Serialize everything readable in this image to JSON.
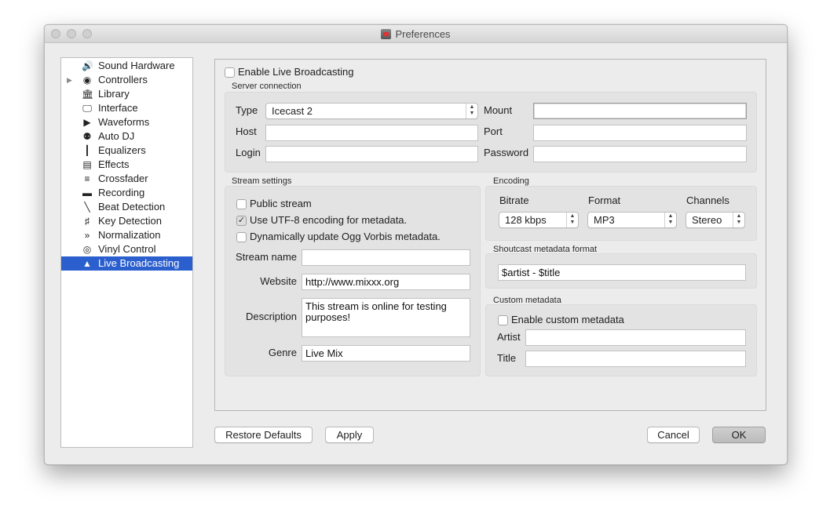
{
  "window": {
    "title": "Preferences"
  },
  "sidebar": {
    "items": [
      {
        "label": "Sound Hardware",
        "icon": "speaker-icon",
        "glyph": "🔊"
      },
      {
        "label": "Controllers",
        "icon": "controller-icon",
        "glyph": "◉",
        "expandable": true
      },
      {
        "label": "Library",
        "icon": "library-icon",
        "glyph": "🏛"
      },
      {
        "label": "Interface",
        "icon": "monitor-icon",
        "glyph": "🖵"
      },
      {
        "label": "Waveforms",
        "icon": "waveform-icon",
        "glyph": "▶"
      },
      {
        "label": "Auto DJ",
        "icon": "robot-icon",
        "glyph": "⚉"
      },
      {
        "label": "Equalizers",
        "icon": "equalizer-icon",
        "glyph": "┃"
      },
      {
        "label": "Effects",
        "icon": "effects-icon",
        "glyph": "▤"
      },
      {
        "label": "Crossfader",
        "icon": "crossfader-icon",
        "glyph": "≡"
      },
      {
        "label": "Recording",
        "icon": "recording-icon",
        "glyph": "▬"
      },
      {
        "label": "Beat Detection",
        "icon": "beat-detection-icon",
        "glyph": "╲"
      },
      {
        "label": "Key Detection",
        "icon": "key-detection-icon",
        "glyph": "♯"
      },
      {
        "label": "Normalization",
        "icon": "normalization-icon",
        "glyph": "»"
      },
      {
        "label": "Vinyl Control",
        "icon": "vinyl-icon",
        "glyph": "◎"
      },
      {
        "label": "Live Broadcasting",
        "icon": "broadcast-icon",
        "glyph": "▲",
        "selected": true
      }
    ]
  },
  "panel": {
    "enable_live_broadcasting": "Enable Live Broadcasting",
    "server": {
      "group_label": "Server connection",
      "type_label": "Type",
      "type_value": "Icecast 2",
      "mount_label": "Mount",
      "mount_value": "",
      "host_label": "Host",
      "host_value": "",
      "port_label": "Port",
      "port_value": "",
      "login_label": "Login",
      "login_value": "",
      "password_label": "Password",
      "password_value": ""
    },
    "stream": {
      "group_label": "Stream settings",
      "public_stream": "Public stream",
      "public_checked": false,
      "utf8": "Use UTF-8 encoding for metadata.",
      "utf8_checked": true,
      "ogg_update": "Dynamically update Ogg Vorbis metadata.",
      "ogg_checked": false,
      "name_label": "Stream name",
      "name_value": "",
      "website_label": "Website",
      "website_value": "http://www.mixxx.org",
      "description_label": "Description",
      "description_value": "This stream is online for testing purposes!",
      "genre_label": "Genre",
      "genre_value": "Live Mix"
    },
    "encoding": {
      "group_label": "Encoding",
      "bitrate_label": "Bitrate",
      "bitrate_value": "128 kbps",
      "format_label": "Format",
      "format_value": "MP3",
      "channels_label": "Channels",
      "channels_value": "Stereo"
    },
    "shoutcast": {
      "group_label": "Shoutcast metadata format",
      "value": "$artist - $title"
    },
    "custom": {
      "group_label": "Custom metadata",
      "enable": "Enable custom metadata",
      "enable_checked": false,
      "artist_label": "Artist",
      "artist_value": "",
      "title_label": "Title",
      "title_value": ""
    }
  },
  "buttons": {
    "restore": "Restore Defaults",
    "apply": "Apply",
    "cancel": "Cancel",
    "ok": "OK"
  },
  "colors": {
    "selection": "#2c5fce",
    "window_bg": "#ececec"
  }
}
